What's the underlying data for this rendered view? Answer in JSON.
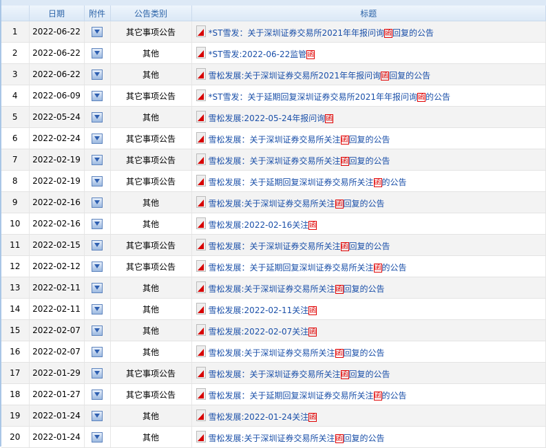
{
  "headers": {
    "num": "",
    "date": "日期",
    "attach": "附件",
    "category": "公告类别",
    "title": "标题"
  },
  "highlight": "函",
  "rows": [
    {
      "n": "1",
      "date": "2022-06-22",
      "cat": "其它事项公告",
      "pre": "*ST雪发：关于深圳证券交易所2021年年报问询",
      "post": "回复的公告"
    },
    {
      "n": "2",
      "date": "2022-06-22",
      "cat": "其他",
      "pre": "*ST雪发:2022-06-22监管",
      "post": ""
    },
    {
      "n": "3",
      "date": "2022-06-22",
      "cat": "其他",
      "pre": "雪松发展:关于深圳证券交易所2021年年报问询",
      "post": "回复的公告"
    },
    {
      "n": "4",
      "date": "2022-06-09",
      "cat": "其它事项公告",
      "pre": "*ST雪发：关于延期回复深圳证券交易所2021年年报问询",
      "post": "的公告"
    },
    {
      "n": "5",
      "date": "2022-05-24",
      "cat": "其他",
      "pre": "雪松发展:2022-05-24年报问询",
      "post": ""
    },
    {
      "n": "6",
      "date": "2022-02-24",
      "cat": "其它事项公告",
      "pre": "雪松发展：关于深圳证券交易所关注",
      "post": "回复的公告"
    },
    {
      "n": "7",
      "date": "2022-02-19",
      "cat": "其它事项公告",
      "pre": "雪松发展：关于深圳证券交易所关注",
      "post": "回复的公告"
    },
    {
      "n": "8",
      "date": "2022-02-19",
      "cat": "其它事项公告",
      "pre": "雪松发展：关于延期回复深圳证券交易所关注",
      "post": "的公告"
    },
    {
      "n": "9",
      "date": "2022-02-16",
      "cat": "其他",
      "pre": "雪松发展:关于深圳证券交易所关注",
      "post": "回复的公告"
    },
    {
      "n": "10",
      "date": "2022-02-16",
      "cat": "其他",
      "pre": "雪松发展:2022-02-16关注",
      "post": ""
    },
    {
      "n": "11",
      "date": "2022-02-15",
      "cat": "其它事项公告",
      "pre": "雪松发展：关于深圳证券交易所关注",
      "post": "回复的公告"
    },
    {
      "n": "12",
      "date": "2022-02-12",
      "cat": "其它事项公告",
      "pre": "雪松发展：关于延期回复深圳证券交易所关注",
      "post": "的公告"
    },
    {
      "n": "13",
      "date": "2022-02-11",
      "cat": "其他",
      "pre": "雪松发展:关于深圳证券交易所关注",
      "post": "回复的公告"
    },
    {
      "n": "14",
      "date": "2022-02-11",
      "cat": "其他",
      "pre": "雪松发展:2022-02-11关注",
      "post": ""
    },
    {
      "n": "15",
      "date": "2022-02-07",
      "cat": "其他",
      "pre": "雪松发展:2022-02-07关注",
      "post": ""
    },
    {
      "n": "16",
      "date": "2022-02-07",
      "cat": "其他",
      "pre": "雪松发展:关于深圳证券交易所关注",
      "post": "回复的公告"
    },
    {
      "n": "17",
      "date": "2022-01-29",
      "cat": "其它事项公告",
      "pre": "雪松发展：关于深圳证券交易所关注",
      "post": "回复的公告"
    },
    {
      "n": "18",
      "date": "2022-01-27",
      "cat": "其它事项公告",
      "pre": "雪松发展：关于延期回复深圳证券交易所关注",
      "post": "的公告"
    },
    {
      "n": "19",
      "date": "2022-01-24",
      "cat": "其他",
      "pre": "雪松发展:2022-01-24关注",
      "post": ""
    },
    {
      "n": "20",
      "date": "2022-01-24",
      "cat": "其他",
      "pre": "雪松发展:关于深圳证券交易所关注",
      "post": "回复的公告"
    }
  ]
}
